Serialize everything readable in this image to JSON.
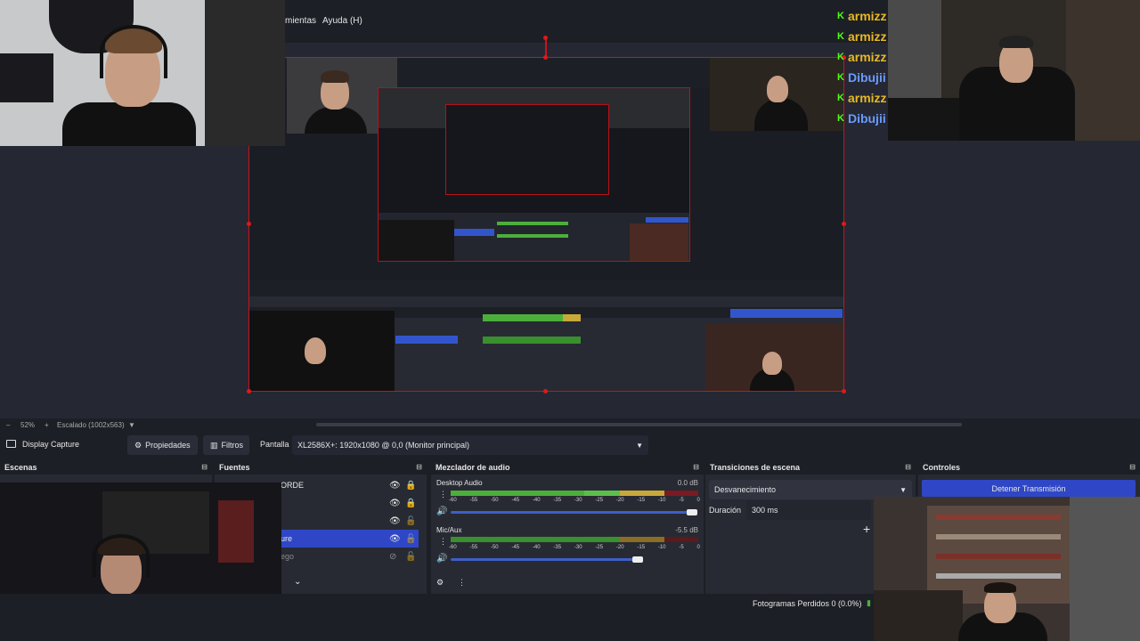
{
  "menu": {
    "item_1": "mientas",
    "item_2": "Ayuda (H)"
  },
  "chat": [
    {
      "user": "armizz",
      "color": "#e8b923"
    },
    {
      "user": "armizz",
      "color": "#e8b923"
    },
    {
      "user": "armizz",
      "color": "#e8b923"
    },
    {
      "user": "Dibujii",
      "color": "#6b9bff"
    },
    {
      "user": "armizz",
      "color": "#e8b923"
    },
    {
      "user": "Dibujii",
      "color": "#6b9bff"
    }
  ],
  "zoom": {
    "percent": "52%",
    "scale_label": "Escalado (1002x563)"
  },
  "source_toolbar": {
    "source_name": "Display Capture",
    "properties": "Propiedades",
    "filters": "Filtros",
    "screen_label": "Pantalla",
    "screen_value": "XL2586X+: 1920x1080 @ 0,0 (Monitor principal)"
  },
  "docks": {
    "scenes": "Escenas",
    "sources": "Fuentes",
    "mixer": "Mezclador de audio",
    "transitions": "Transiciones de escena",
    "controls": "Controles"
  },
  "sources_list": [
    "ORDE",
    "",
    "",
    "ure",
    "ego"
  ],
  "mixer": {
    "ch1_name": "Desktop Audio",
    "ch1_db": "0.0 dB",
    "ch2_name": "Mic/Aux",
    "ch2_db": "-5.5 dB",
    "ticks": [
      "-60",
      "-55",
      "-50",
      "-45",
      "-40",
      "-35",
      "-30",
      "-25",
      "-20",
      "-15",
      "-10",
      "-5",
      "0"
    ]
  },
  "transitions": {
    "type": "Desvanecimiento",
    "duration_label": "Duración",
    "duration_value": "300 ms"
  },
  "controls": {
    "stop_stream": "Detener Transmisión"
  },
  "status": {
    "dropped_frames": "Fotogramas Perdidos 0 (0.0%)"
  },
  "colors": {
    "accent": "#3355cc",
    "red": "#d0101a",
    "meter_green": "#4caf3c",
    "meter_yellow": "#c9a83a",
    "meter_red": "#b3202a"
  }
}
